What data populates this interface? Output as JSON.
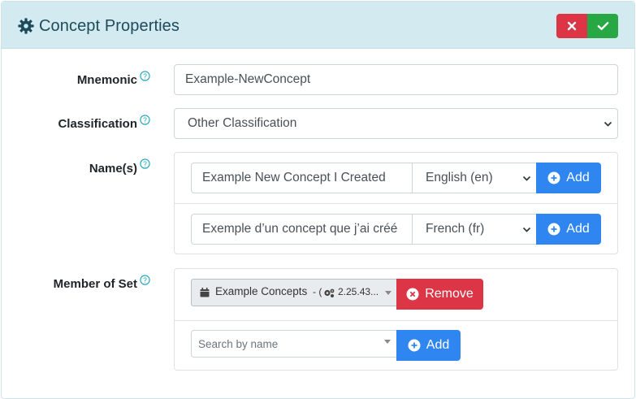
{
  "header": {
    "title": "Concept Properties",
    "cancel_icon": "close-icon",
    "ok_icon": "check-icon"
  },
  "fields": {
    "mnemonic": {
      "label": "Mnemonic",
      "value": "Example-NewConcept"
    },
    "classification": {
      "label": "Classification",
      "value": "Other Classification"
    },
    "names": {
      "label": "Name(s)",
      "rows": [
        {
          "value": "Example New Concept I Created",
          "language": "English (en)",
          "button": "Add"
        },
        {
          "value": "Exemple d’un concept que j’ai créé",
          "language": "French (fr)",
          "button": "Add"
        }
      ]
    },
    "member_of_set": {
      "label": "Member of Set",
      "selected_name": "Example Concepts",
      "selected_suffix": "- (",
      "selected_oid": "2.25.43...",
      "remove_button": "Remove",
      "search_placeholder": "Search by name",
      "add_button": "Add"
    }
  },
  "colors": {
    "header_bg": "#d3eaf0",
    "title": "#1f4a5a",
    "danger": "#dc3545",
    "success": "#28a745",
    "primary": "#2f86f0",
    "help_icon": "#17a2b8"
  }
}
